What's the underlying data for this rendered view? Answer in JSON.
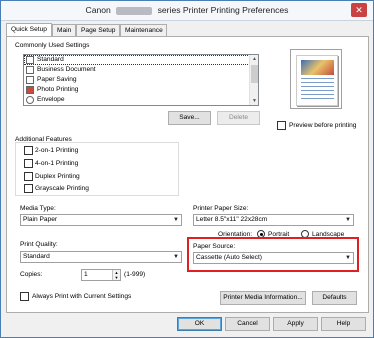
{
  "window": {
    "title_prefix": "Canon",
    "title_suffix": "series Printer Printing Preferences",
    "close_glyph": "✕"
  },
  "tabs": [
    {
      "label": "Quick Setup"
    },
    {
      "label": "Main"
    },
    {
      "label": "Page Setup"
    },
    {
      "label": "Maintenance"
    }
  ],
  "commonly_used": {
    "heading": "Commonly Used Settings",
    "items": [
      {
        "label": "Standard",
        "icon": "printer-document-icon"
      },
      {
        "label": "Business Document",
        "icon": "business-document-icon"
      },
      {
        "label": "Paper Saving",
        "icon": "paper-saving-icon"
      },
      {
        "label": "Photo Printing",
        "icon": "photo-printing-icon"
      },
      {
        "label": "Envelope",
        "icon": "envelope-icon"
      }
    ],
    "save_label": "Save...",
    "delete_label": "Delete"
  },
  "preview": {
    "checkbox_label": "Preview before printing",
    "checked": false
  },
  "additional_features": {
    "heading": "Additional Features",
    "items": [
      {
        "label": "2-on-1 Printing",
        "checked": false
      },
      {
        "label": "4-on-1 Printing",
        "checked": false
      },
      {
        "label": "Duplex Printing",
        "checked": false
      },
      {
        "label": "Grayscale Printing",
        "checked": false
      }
    ]
  },
  "media_type": {
    "label": "Media Type:",
    "value": "Plain Paper"
  },
  "printer_paper_size": {
    "label": "Printer Paper Size:",
    "value": "Letter 8.5\"x11\" 22x28cm"
  },
  "orientation": {
    "label": "Orientation:",
    "options": [
      {
        "label": "Portrait",
        "checked": true
      },
      {
        "label": "Landscape",
        "checked": false
      }
    ]
  },
  "print_quality": {
    "label": "Print Quality:",
    "value": "Standard"
  },
  "paper_source": {
    "label": "Paper Source:",
    "value": "Cassette (Auto Select)"
  },
  "copies": {
    "label": "Copies:",
    "value": "1",
    "range": "(1-999)"
  },
  "always_print": {
    "label": "Always Print with Current Settings",
    "checked": false
  },
  "buttons": {
    "printer_media_info": "Printer Media Information...",
    "defaults": "Defaults",
    "ok": "OK",
    "cancel": "Cancel",
    "apply": "Apply",
    "help": "Help"
  },
  "colors": {
    "highlight": "#e02020",
    "accent": "#3c7fb1"
  }
}
